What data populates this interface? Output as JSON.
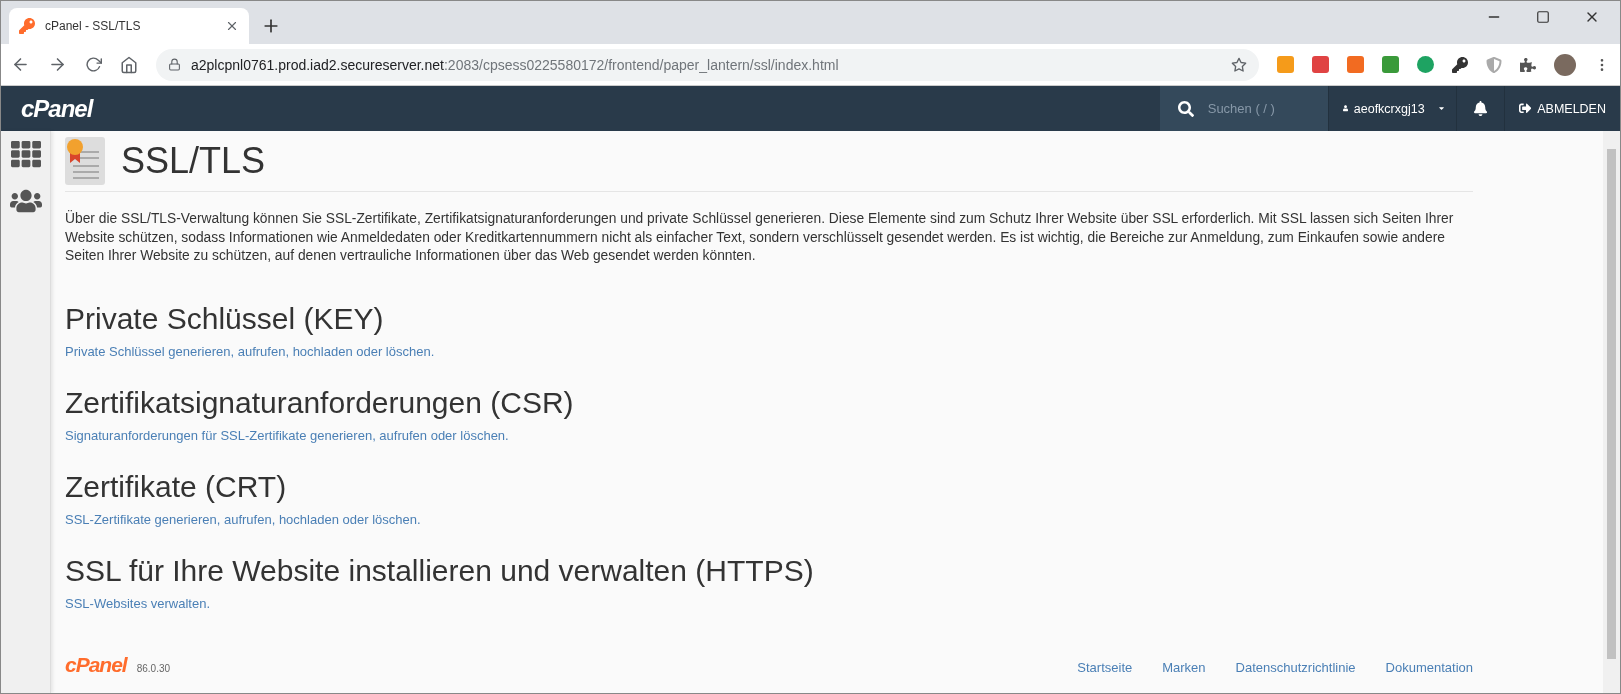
{
  "browser": {
    "tab": {
      "title": "cPanel - SSL/TLS",
      "selected": true
    },
    "url": {
      "host": "a2plcpnl0761.prod.iad2.secureserver.net",
      "path": ":2083/cpsess0225580172/frontend/paper_lantern/ssl/index.html"
    }
  },
  "header": {
    "logo": "cPanel",
    "search": {
      "placeholder": "Suchen ( / )"
    },
    "user": "aeofkcrxgj13",
    "logout": "ABMELDEN"
  },
  "page": {
    "title": "SSL/TLS",
    "description": "Über die SSL/TLS-Verwaltung können Sie SSL-Zertifikate, Zertifikatsignaturanforderungen und private Schlüssel generieren. Diese Elemente sind zum Schutz Ihrer Website über SSL erforderlich. Mit SSL lassen sich Seiten Ihrer Website schützen, sodass Informationen wie Anmeldedaten oder Kreditkartennummern nicht als einfacher Text, sondern verschlüsselt gesendet werden. Es ist wichtig, die Bereiche zur Anmeldung, zum Einkaufen sowie andere Seiten Ihrer Website zu schützen, auf denen vertrauliche Informationen über das Web gesendet werden könnten."
  },
  "sections": [
    {
      "heading": "Private Schlüssel (KEY)",
      "link": "Private Schlüssel generieren, aufrufen, hochladen oder löschen."
    },
    {
      "heading": "Zertifikatsignaturanforderungen (CSR)",
      "link": "Signaturanforderungen für SSL-Zertifikate generieren, aufrufen oder löschen."
    },
    {
      "heading": "Zertifikate (CRT)",
      "link": "SSL-Zertifikate generieren, aufrufen, hochladen oder löschen."
    },
    {
      "heading": "SSL für Ihre Website installieren und verwalten (HTTPS)",
      "link": "SSL-Websites verwalten."
    }
  ],
  "footer": {
    "logo": "cPanel",
    "version": "86.0.30",
    "links": [
      "Startseite",
      "Marken",
      "Datenschutzrichtlinie",
      "Dokumentation"
    ]
  }
}
